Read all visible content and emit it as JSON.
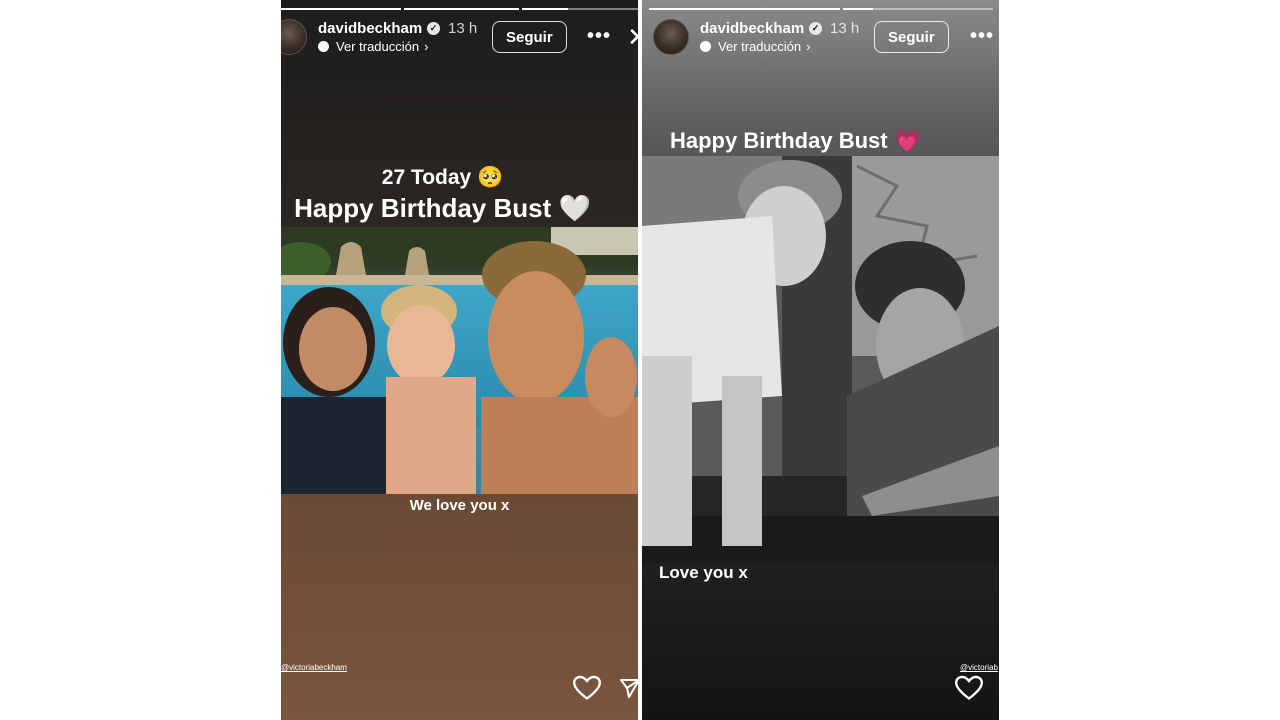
{
  "stories": [
    {
      "username": "davidbeckham",
      "time": "13 h",
      "translate": "Ver traducción",
      "follow_label": "Seguir",
      "more": "•••",
      "close": "✕",
      "caption_line1": "27 Today 🥺",
      "caption_line2": "Happy Birthday Bust 🤍",
      "caption_bottom": "We love you x",
      "mention": "@victoriabeckham",
      "progress": [
        1.0,
        1.0,
        0.4
      ]
    },
    {
      "username": "davidbeckham",
      "time": "13 h",
      "translate": "Ver traducción",
      "follow_label": "Seguir",
      "more": "•••",
      "caption_top": "Happy Birthday Bust 💗",
      "caption_bottom": "Love you x",
      "mention": "@victoriab",
      "progress": [
        1.0,
        0.2
      ]
    }
  ],
  "icons": {
    "verified": "verified-badge-icon",
    "translate": "speech-bubble-icon",
    "chevron": "chevron-right-icon",
    "like": "heart-icon",
    "share": "send-icon"
  }
}
